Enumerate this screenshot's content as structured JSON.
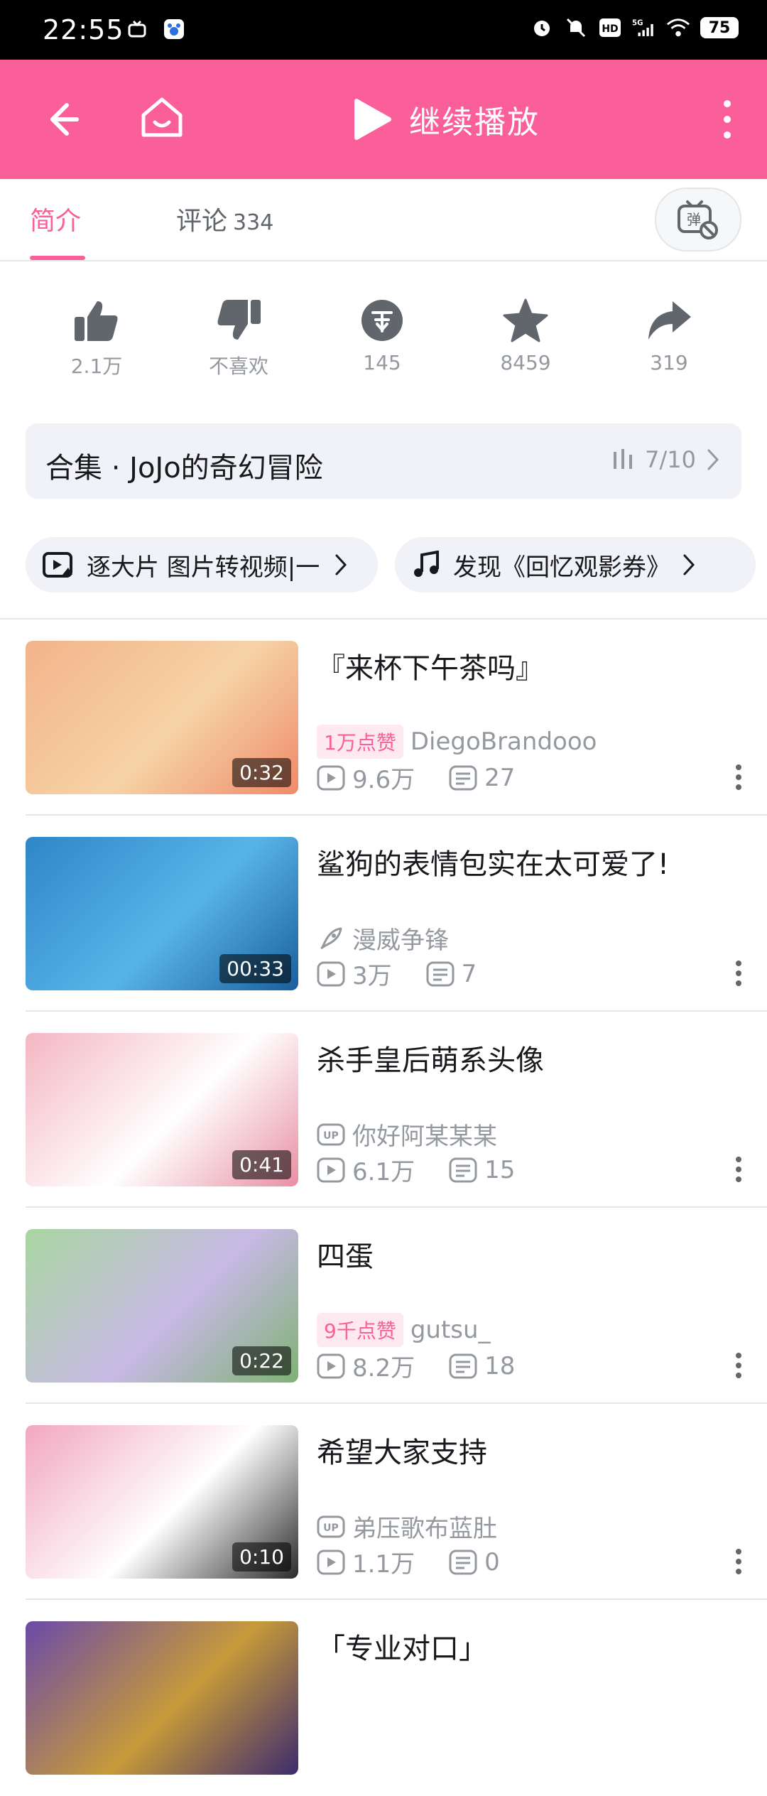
{
  "status_bar": {
    "time": "22:55",
    "battery": "75"
  },
  "topbar": {
    "continue_label": "继续播放"
  },
  "tabs": {
    "intro": "简介",
    "comments": "评论",
    "comments_count": "334",
    "danmaku_label": "弹"
  },
  "actions": [
    {
      "icon": "thumb-up-icon",
      "label": "2.1万"
    },
    {
      "icon": "thumb-down-icon",
      "label": "不喜欢"
    },
    {
      "icon": "coin-icon",
      "label": "145"
    },
    {
      "icon": "star-icon",
      "label": "8459"
    },
    {
      "icon": "share-icon",
      "label": "319"
    }
  ],
  "collection": {
    "title": "合集 · JoJo的奇幻冒险",
    "progress": "7/10"
  },
  "tags": [
    {
      "icon": "video-image-icon",
      "text": "逐大片   图片转视频|一"
    },
    {
      "icon": "music-note-icon",
      "text": "发现《回忆观影券》"
    }
  ],
  "videos": [
    {
      "title": "『来杯下午茶吗』",
      "duration": "0:32",
      "badge": "1万点赞",
      "author": "DiegoBrandooo",
      "author_icon": "",
      "views": "9.6万",
      "comments": "27",
      "thumb_colors": [
        "#f3b38a",
        "#f6d3a6",
        "#ef8a6a"
      ]
    },
    {
      "title": "鲨狗的表情包实在太可爱了!",
      "duration": "00:33",
      "badge": "",
      "author": "漫威争锋",
      "author_icon": "rocket-icon",
      "views": "3万",
      "comments": "7",
      "thumb_colors": [
        "#2f86c8",
        "#58b4e8",
        "#1a5f9c"
      ]
    },
    {
      "title": "杀手皇后萌系头像",
      "duration": "0:41",
      "badge": "",
      "author": "你好阿某某某",
      "author_icon": "up-icon",
      "views": "6.1万",
      "comments": "15",
      "thumb_colors": [
        "#f4b6c2",
        "#ffffff",
        "#e88fa3"
      ]
    },
    {
      "title": "四蛋",
      "duration": "0:22",
      "badge": "9千点赞",
      "author": "gutsu_",
      "author_icon": "",
      "views": "8.2万",
      "comments": "18",
      "thumb_colors": [
        "#a9d6a0",
        "#c7b9e4",
        "#7fb273"
      ]
    },
    {
      "title": "希望大家支持",
      "duration": "0:10",
      "badge": "",
      "author": "弟压歌布蓝肚",
      "author_icon": "up-icon",
      "views": "1.1万",
      "comments": "0",
      "thumb_colors": [
        "#f2a6c1",
        "#ffffff",
        "#2b2b2b"
      ]
    },
    {
      "title": "「专业对口」",
      "duration": "",
      "badge": "",
      "author": "",
      "author_icon": "",
      "views": "",
      "comments": "",
      "thumb_colors": [
        "#6b4aa8",
        "#c79a3a",
        "#3d2b6e"
      ]
    }
  ],
  "colors": {
    "brand_pink": "#fb5f99",
    "text_primary": "#18191c",
    "text_secondary": "#9499a0"
  }
}
